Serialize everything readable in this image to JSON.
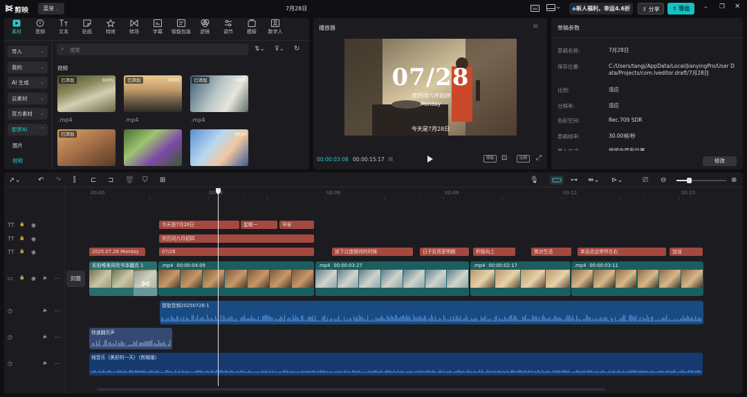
{
  "app": {
    "name": "剪映",
    "menu_label": "菜单",
    "project_title": "7月28日",
    "promo_label": "新人福利，幸运4.6折",
    "share_label": "分享",
    "export_label": "导出"
  },
  "tools": [
    {
      "label": "素材",
      "icon": "media-icon",
      "active": true
    },
    {
      "label": "音频",
      "icon": "audio-icon"
    },
    {
      "label": "文本",
      "icon": "text-icon"
    },
    {
      "label": "贴纸",
      "icon": "sticker-icon"
    },
    {
      "label": "特效",
      "icon": "effects-icon"
    },
    {
      "label": "转场",
      "icon": "transition-icon"
    },
    {
      "label": "字幕",
      "icon": "subtitle-icon"
    },
    {
      "label": "智能包装",
      "icon": "smart-pack-icon"
    },
    {
      "label": "滤镜",
      "icon": "filter-icon"
    },
    {
      "label": "调节",
      "icon": "adjust-icon"
    },
    {
      "label": "模板",
      "icon": "template-icon"
    },
    {
      "label": "数字人",
      "icon": "digital-human-icon"
    }
  ],
  "sidebar": {
    "items": [
      {
        "label": "导入",
        "has_chevron": true
      },
      {
        "label": "我的",
        "has_chevron": true
      },
      {
        "label": "AI 生成",
        "has_chevron": true
      },
      {
        "label": "云素材",
        "has_chevron": true
      },
      {
        "label": "官方素材",
        "has_chevron": true
      },
      {
        "label": "即梦AI",
        "has_chevron": true,
        "active": true
      }
    ],
    "sub_items": [
      {
        "label": "图片"
      },
      {
        "label": "视频",
        "active": true
      }
    ]
  },
  "media": {
    "search_placeholder": "搜索",
    "section_label": "视频",
    "thumbs": [
      {
        "tag": "已添加",
        "duration": "0005",
        "caption": ".mp4",
        "scene": "book"
      },
      {
        "tag": "已添加",
        "duration": "0005",
        "caption": ".mp4",
        "scene": "lake"
      },
      {
        "tag": "已添加",
        "duration": "0005",
        "caption": ".mp4",
        "scene": "boy-phone"
      },
      {
        "tag": "已添加",
        "duration": "",
        "caption": "",
        "scene": "kitchen"
      },
      {
        "tag": "",
        "duration": "",
        "caption": "",
        "scene": "girl-grapes"
      },
      {
        "tag": "",
        "duration": "0010",
        "caption": "",
        "scene": "boy-3d"
      }
    ]
  },
  "player": {
    "title": "播放器",
    "big_date": "07/28",
    "sub_line_1": "农历闰六月初四",
    "sub_line_2": "Monday",
    "bottom_caption": "今天是7月28日",
    "current_time": "00:00:03:08",
    "total_time": "00:00:15:17",
    "ratio_label": "原始",
    "fit_label": "比例"
  },
  "draft": {
    "title": "草稿参数",
    "fields": [
      {
        "label": "草稿名称:",
        "value": "7月28日"
      },
      {
        "label": "保存位置:",
        "value": "C:/Users/tangj/AppData/Local/JianyingPro/User Data/Projects/com.lveditor.draft/7月28日"
      },
      {
        "label": "比例:",
        "value": "适应"
      },
      {
        "label": "分辨率:",
        "value": "适应"
      },
      {
        "label": "色彩空间:",
        "value": "Rec.709 SDR"
      },
      {
        "label": "草稿帧率:",
        "value": "30.00帧/秒"
      },
      {
        "label": "导入方式:",
        "value": "保留在原有位置"
      }
    ],
    "modify_label": "修改"
  },
  "timeline": {
    "ruler": [
      "00:00",
      "00:03",
      "00:06",
      "00:09",
      "00:12",
      "00:15"
    ],
    "cover_label": "封面",
    "text_track_1": [
      "今天是7月28日",
      "星期一",
      "早安"
    ],
    "text_track_2": [
      "农历闰六月初四"
    ],
    "text_track_3": [
      "2025.07.28 Monday",
      "07/28",
      "放下过度期待的时候",
      "日子反而更明朗",
      "积极向上",
      "笑对生活",
      "幸运总会常伴左右",
      "加油"
    ],
    "video_clips": [
      {
        "label": "实拍唯美风吹书本翻页 1"
      },
      {
        "label": ".mp4",
        "duration": "00:00:04:09"
      },
      {
        "label": ".mp4",
        "duration": "00:00:03:27"
      },
      {
        "label": ".mp4",
        "duration": "00:00:02:17"
      },
      {
        "label": ".mp4",
        "duration": "00:00:03:11"
      }
    ],
    "audio_clips": [
      {
        "label": "提取音频20250728-1"
      },
      {
        "label": "快速翻页声"
      },
      {
        "label": "纯音乐（美好的一天）（剪辑版）"
      }
    ]
  }
}
